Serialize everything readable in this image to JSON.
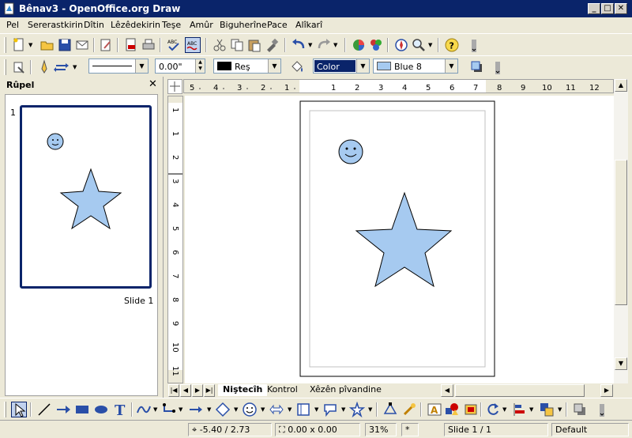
{
  "window": {
    "title": "Bênav3 - OpenOffice.org Draw"
  },
  "menu": [
    "Pel",
    "Sererastkirin",
    "Dîtin",
    "Lêzêdekirin",
    "Teşe",
    "Amûr",
    "Biguherîne",
    "Pace",
    "Alîkarî"
  ],
  "line_props": {
    "line_width": "0.00\"",
    "line_color": "Reş",
    "area_style": "Color",
    "area_color": "Blue 8"
  },
  "panel": {
    "title": "Rûpel",
    "slide_number": "1",
    "slide_label": "Slide 1"
  },
  "tabs": [
    "Niştecîh",
    "Kontrol",
    "Xêzên pîvandine"
  ],
  "ruler": {
    "h_labels": [
      "5",
      "4",
      "3",
      "2",
      "1",
      "1",
      "2",
      "3",
      "4",
      "5",
      "6",
      "7",
      "8",
      "9",
      "10",
      "11",
      "12"
    ],
    "v_labels": [
      "1",
      "1",
      "2",
      "3",
      "4",
      "5",
      "6",
      "7",
      "8",
      "9",
      "10",
      "11"
    ]
  },
  "status": {
    "position": "-5.40 / 2.73",
    "size": "0.00 x 0.00",
    "zoom": "31%",
    "modified": "*",
    "slide": "Slide 1 / 1",
    "layout": "Default"
  },
  "colors": {
    "shape_fill": "#a6caf0",
    "title_bar": "#0a246a",
    "selection": "#0a246a"
  },
  "icons": {
    "standard": [
      "new-document-icon",
      "open-icon",
      "save-icon",
      "email-icon",
      "edit-file-icon",
      "export-pdf-icon",
      "print-icon",
      "spellcheck-icon",
      "autospellcheck-icon",
      "cut-icon",
      "copy-icon",
      "paste-icon",
      "format-paintbrush-icon",
      "undo-icon",
      "redo-icon",
      "chart-icon",
      "navigator-icon",
      "zoom-icon",
      "help-icon"
    ],
    "drawing": [
      "select-icon",
      "line-icon",
      "arrow-line-icon",
      "rectangle-icon",
      "ellipse-icon",
      "text-icon",
      "curve-icon",
      "connector-icon",
      "lines-arrows-icon",
      "basic-shapes-icon",
      "symbol-shapes-icon",
      "block-arrows-icon",
      "flowchart-icon",
      "callouts-icon",
      "stars-icon",
      "points-icon",
      "glue-points-icon",
      "fontwork-icon",
      "from-file-icon",
      "gallery-icon",
      "rotate-icon",
      "align-icon",
      "arrange-icon",
      "shadow-icon"
    ]
  }
}
